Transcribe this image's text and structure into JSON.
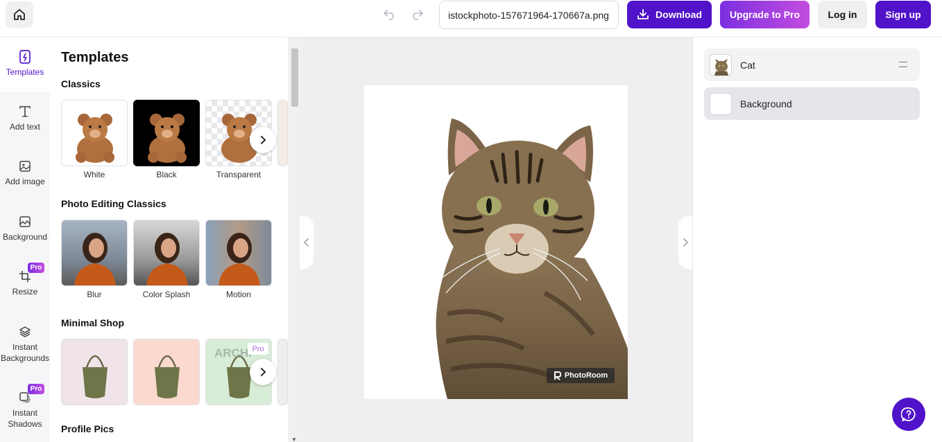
{
  "topbar": {
    "filename": "istockphoto-157671964-170667a.png",
    "download_label": "Download",
    "upgrade_label": "Upgrade to Pro",
    "login_label": "Log in",
    "signup_label": "Sign up",
    "icons": [
      "home-icon",
      "undo-icon",
      "redo-icon",
      "download-icon"
    ]
  },
  "rail": {
    "items": [
      {
        "label": "Templates",
        "icon": "templates-icon",
        "active": true
      },
      {
        "label": "Add text",
        "icon": "text-icon"
      },
      {
        "label": "Add image",
        "icon": "image-icon"
      },
      {
        "label": "Background",
        "icon": "background-icon"
      },
      {
        "label": "Resize",
        "icon": "crop-icon",
        "badge": "Pro"
      },
      {
        "label": "Instant Backgrounds",
        "icon": "layers-icon"
      },
      {
        "label": "Instant Shadows",
        "icon": "shadow-icon",
        "badge": "Pro"
      }
    ]
  },
  "panel": {
    "title": "Templates",
    "sections": [
      {
        "title": "Classics",
        "items": [
          {
            "label": "White"
          },
          {
            "label": "Black"
          },
          {
            "label": "Transparent"
          }
        ]
      },
      {
        "title": "Photo Editing Classics",
        "items": [
          {
            "label": "Blur"
          },
          {
            "label": "Color Splash"
          },
          {
            "label": "Motion"
          }
        ]
      },
      {
        "title": "Minimal Shop",
        "items": [
          {
            "label": ""
          },
          {
            "label": ""
          },
          {
            "label": "",
            "badge": "Pro",
            "text": "ARCHI"
          }
        ]
      },
      {
        "title": "Profile Pics"
      }
    ]
  },
  "canvas": {
    "watermark": "PhotoRoom"
  },
  "layers": [
    {
      "name": "Cat"
    },
    {
      "name": "Background",
      "selected": true
    }
  ],
  "colors": {
    "accent": "#5013c9",
    "pro_gradient_start": "#7b2fe0",
    "pro_gradient_end": "#c34ddf",
    "canvas_bg": "#efeff2"
  }
}
